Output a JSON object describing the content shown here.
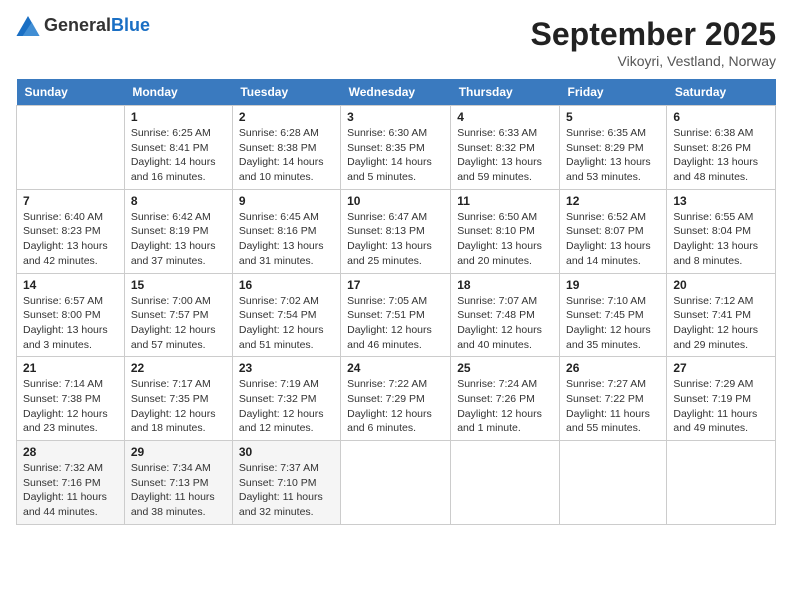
{
  "header": {
    "logo_general": "General",
    "logo_blue": "Blue",
    "title": "September 2025",
    "location": "Vikoyri, Vestland, Norway"
  },
  "weekdays": [
    "Sunday",
    "Monday",
    "Tuesday",
    "Wednesday",
    "Thursday",
    "Friday",
    "Saturday"
  ],
  "weeks": [
    [
      null,
      {
        "day": "1",
        "sunrise": "Sunrise: 6:25 AM",
        "sunset": "Sunset: 8:41 PM",
        "daylight": "Daylight: 14 hours and 16 minutes."
      },
      {
        "day": "2",
        "sunrise": "Sunrise: 6:28 AM",
        "sunset": "Sunset: 8:38 PM",
        "daylight": "Daylight: 14 hours and 10 minutes."
      },
      {
        "day": "3",
        "sunrise": "Sunrise: 6:30 AM",
        "sunset": "Sunset: 8:35 PM",
        "daylight": "Daylight: 14 hours and 5 minutes."
      },
      {
        "day": "4",
        "sunrise": "Sunrise: 6:33 AM",
        "sunset": "Sunset: 8:32 PM",
        "daylight": "Daylight: 13 hours and 59 minutes."
      },
      {
        "day": "5",
        "sunrise": "Sunrise: 6:35 AM",
        "sunset": "Sunset: 8:29 PM",
        "daylight": "Daylight: 13 hours and 53 minutes."
      },
      {
        "day": "6",
        "sunrise": "Sunrise: 6:38 AM",
        "sunset": "Sunset: 8:26 PM",
        "daylight": "Daylight: 13 hours and 48 minutes."
      }
    ],
    [
      {
        "day": "7",
        "sunrise": "Sunrise: 6:40 AM",
        "sunset": "Sunset: 8:23 PM",
        "daylight": "Daylight: 13 hours and 42 minutes."
      },
      {
        "day": "8",
        "sunrise": "Sunrise: 6:42 AM",
        "sunset": "Sunset: 8:19 PM",
        "daylight": "Daylight: 13 hours and 37 minutes."
      },
      {
        "day": "9",
        "sunrise": "Sunrise: 6:45 AM",
        "sunset": "Sunset: 8:16 PM",
        "daylight": "Daylight: 13 hours and 31 minutes."
      },
      {
        "day": "10",
        "sunrise": "Sunrise: 6:47 AM",
        "sunset": "Sunset: 8:13 PM",
        "daylight": "Daylight: 13 hours and 25 minutes."
      },
      {
        "day": "11",
        "sunrise": "Sunrise: 6:50 AM",
        "sunset": "Sunset: 8:10 PM",
        "daylight": "Daylight: 13 hours and 20 minutes."
      },
      {
        "day": "12",
        "sunrise": "Sunrise: 6:52 AM",
        "sunset": "Sunset: 8:07 PM",
        "daylight": "Daylight: 13 hours and 14 minutes."
      },
      {
        "day": "13",
        "sunrise": "Sunrise: 6:55 AM",
        "sunset": "Sunset: 8:04 PM",
        "daylight": "Daylight: 13 hours and 8 minutes."
      }
    ],
    [
      {
        "day": "14",
        "sunrise": "Sunrise: 6:57 AM",
        "sunset": "Sunset: 8:00 PM",
        "daylight": "Daylight: 13 hours and 3 minutes."
      },
      {
        "day": "15",
        "sunrise": "Sunrise: 7:00 AM",
        "sunset": "Sunset: 7:57 PM",
        "daylight": "Daylight: 12 hours and 57 minutes."
      },
      {
        "day": "16",
        "sunrise": "Sunrise: 7:02 AM",
        "sunset": "Sunset: 7:54 PM",
        "daylight": "Daylight: 12 hours and 51 minutes."
      },
      {
        "day": "17",
        "sunrise": "Sunrise: 7:05 AM",
        "sunset": "Sunset: 7:51 PM",
        "daylight": "Daylight: 12 hours and 46 minutes."
      },
      {
        "day": "18",
        "sunrise": "Sunrise: 7:07 AM",
        "sunset": "Sunset: 7:48 PM",
        "daylight": "Daylight: 12 hours and 40 minutes."
      },
      {
        "day": "19",
        "sunrise": "Sunrise: 7:10 AM",
        "sunset": "Sunset: 7:45 PM",
        "daylight": "Daylight: 12 hours and 35 minutes."
      },
      {
        "day": "20",
        "sunrise": "Sunrise: 7:12 AM",
        "sunset": "Sunset: 7:41 PM",
        "daylight": "Daylight: 12 hours and 29 minutes."
      }
    ],
    [
      {
        "day": "21",
        "sunrise": "Sunrise: 7:14 AM",
        "sunset": "Sunset: 7:38 PM",
        "daylight": "Daylight: 12 hours and 23 minutes."
      },
      {
        "day": "22",
        "sunrise": "Sunrise: 7:17 AM",
        "sunset": "Sunset: 7:35 PM",
        "daylight": "Daylight: 12 hours and 18 minutes."
      },
      {
        "day": "23",
        "sunrise": "Sunrise: 7:19 AM",
        "sunset": "Sunset: 7:32 PM",
        "daylight": "Daylight: 12 hours and 12 minutes."
      },
      {
        "day": "24",
        "sunrise": "Sunrise: 7:22 AM",
        "sunset": "Sunset: 7:29 PM",
        "daylight": "Daylight: 12 hours and 6 minutes."
      },
      {
        "day": "25",
        "sunrise": "Sunrise: 7:24 AM",
        "sunset": "Sunset: 7:26 PM",
        "daylight": "Daylight: 12 hours and 1 minute."
      },
      {
        "day": "26",
        "sunrise": "Sunrise: 7:27 AM",
        "sunset": "Sunset: 7:22 PM",
        "daylight": "Daylight: 11 hours and 55 minutes."
      },
      {
        "day": "27",
        "sunrise": "Sunrise: 7:29 AM",
        "sunset": "Sunset: 7:19 PM",
        "daylight": "Daylight: 11 hours and 49 minutes."
      }
    ],
    [
      {
        "day": "28",
        "sunrise": "Sunrise: 7:32 AM",
        "sunset": "Sunset: 7:16 PM",
        "daylight": "Daylight: 11 hours and 44 minutes."
      },
      {
        "day": "29",
        "sunrise": "Sunrise: 7:34 AM",
        "sunset": "Sunset: 7:13 PM",
        "daylight": "Daylight: 11 hours and 38 minutes."
      },
      {
        "day": "30",
        "sunrise": "Sunrise: 7:37 AM",
        "sunset": "Sunset: 7:10 PM",
        "daylight": "Daylight: 11 hours and 32 minutes."
      },
      null,
      null,
      null,
      null
    ]
  ]
}
